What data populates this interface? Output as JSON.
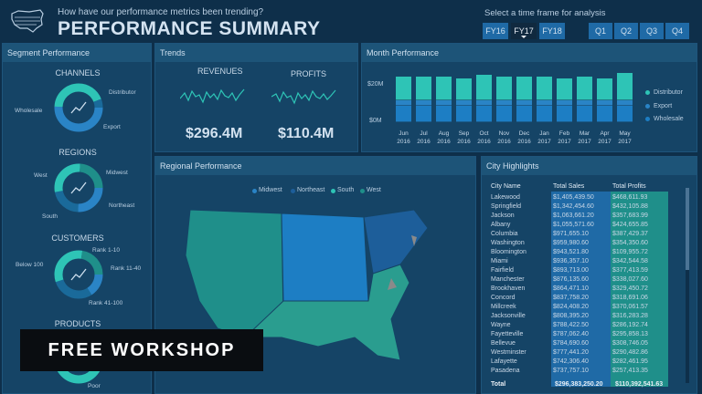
{
  "header": {
    "question": "How have our performance metrics been trending?",
    "title": "PERFORMANCE SUMMARY",
    "timeframe_label": "Select a time frame for analysis",
    "years": [
      "FY16",
      "FY17",
      "FY18"
    ],
    "selected_year": "FY17",
    "quarters": [
      "Q1",
      "Q2",
      "Q3",
      "Q4"
    ]
  },
  "segment": {
    "title": "Segment Performance",
    "channels": {
      "title": "CHANNELS",
      "labels": [
        "Distributor",
        "Wholesale",
        "Export"
      ]
    },
    "regions": {
      "title": "REGIONS",
      "labels": [
        "Midwest",
        "West",
        "Northeast",
        "South"
      ]
    },
    "customers": {
      "title": "CUSTOMERS",
      "labels": [
        "Rank 1-10",
        "Below 100",
        "Rank 11-40",
        "Rank 41-100"
      ]
    },
    "products": {
      "title": "PRODUCTS",
      "labels": [
        "Poor"
      ]
    }
  },
  "trends": {
    "title": "Trends",
    "revenues_label": "REVENUES",
    "revenues_value": "$296.4M",
    "profits_label": "PROFITS",
    "profits_value": "$110.4M"
  },
  "month": {
    "title": "Month Performance",
    "yaxis": [
      "$20M",
      "$0M"
    ],
    "legend": [
      "Distributor",
      "Export",
      "Wholesale"
    ]
  },
  "chart_data": {
    "type": "bar",
    "stacked": true,
    "categories": [
      "Jun 2016",
      "Jul 2016",
      "Aug 2016",
      "Sep 2016",
      "Oct 2016",
      "Nov 2016",
      "Dec 2016",
      "Jan 2017",
      "Feb 2017",
      "Mar 2017",
      "Apr 2017",
      "May 2017"
    ],
    "series": [
      {
        "name": "Wholesale",
        "values": [
          9,
          9,
          9,
          9,
          9,
          9,
          9,
          9,
          9,
          9,
          9,
          9
        ]
      },
      {
        "name": "Export",
        "values": [
          3,
          3,
          3,
          3,
          3,
          3,
          3,
          3,
          3,
          3,
          3,
          3
        ]
      },
      {
        "name": "Distributor",
        "values": [
          13,
          13,
          13,
          12,
          14,
          13,
          13,
          13,
          12,
          13,
          12,
          15
        ]
      }
    ],
    "ylabel": "",
    "ylim": [
      0,
      28
    ]
  },
  "regional": {
    "title": "Regional Performance",
    "legend": [
      "Midwest",
      "Northeast",
      "South",
      "West"
    ]
  },
  "city": {
    "title": "City Highlights",
    "headers": [
      "City Name",
      "Total Sales",
      "Total Profits"
    ],
    "rows": [
      [
        "Lakewood",
        "$1,405,439.50",
        "$468,611.93"
      ],
      [
        "Springfield",
        "$1,342,454.60",
        "$432,105.88"
      ],
      [
        "Jackson",
        "$1,063,661.20",
        "$357,683.99"
      ],
      [
        "Albany",
        "$1,055,571.60",
        "$424,655.85"
      ],
      [
        "Columbia",
        "$971,655.10",
        "$387,429.37"
      ],
      [
        "Washington",
        "$959,980.60",
        "$354,350.60"
      ],
      [
        "Bloomington",
        "$943,521.80",
        "$109,955.72"
      ],
      [
        "Miami",
        "$936,357.10",
        "$342,544.58"
      ],
      [
        "Fairfield",
        "$893,713.00",
        "$377,413.59"
      ],
      [
        "Manchester",
        "$876,135.60",
        "$338,027.60"
      ],
      [
        "Brookhaven",
        "$864,471.10",
        "$329,450.72"
      ],
      [
        "Concord",
        "$837,758.20",
        "$318,691.06"
      ],
      [
        "Millcreek",
        "$824,408.20",
        "$370,061.57"
      ],
      [
        "Jacksonville",
        "$808,395.20",
        "$316,283.28"
      ],
      [
        "Wayne",
        "$788,422.50",
        "$286,192.74"
      ],
      [
        "Fayetteville",
        "$787,062.40",
        "$295,858.13"
      ],
      [
        "Bellevue",
        "$784,690.60",
        "$308,746.05"
      ],
      [
        "Westminster",
        "$777,441.20",
        "$290,482.86"
      ],
      [
        "Lafayette",
        "$742,306.40",
        "$282,461.95"
      ],
      [
        "Pasadena",
        "$737,757.10",
        "$257,413.35"
      ]
    ],
    "total": [
      "Total",
      "$296,383,250.20",
      "$110,392,541.63"
    ]
  },
  "overlay": {
    "text": "FREE WORKSHOP"
  },
  "colors": {
    "bg": "#0e2f4a",
    "panel": "#154466",
    "accent": "#2ec4b6",
    "blue": "#1f6aa6"
  }
}
